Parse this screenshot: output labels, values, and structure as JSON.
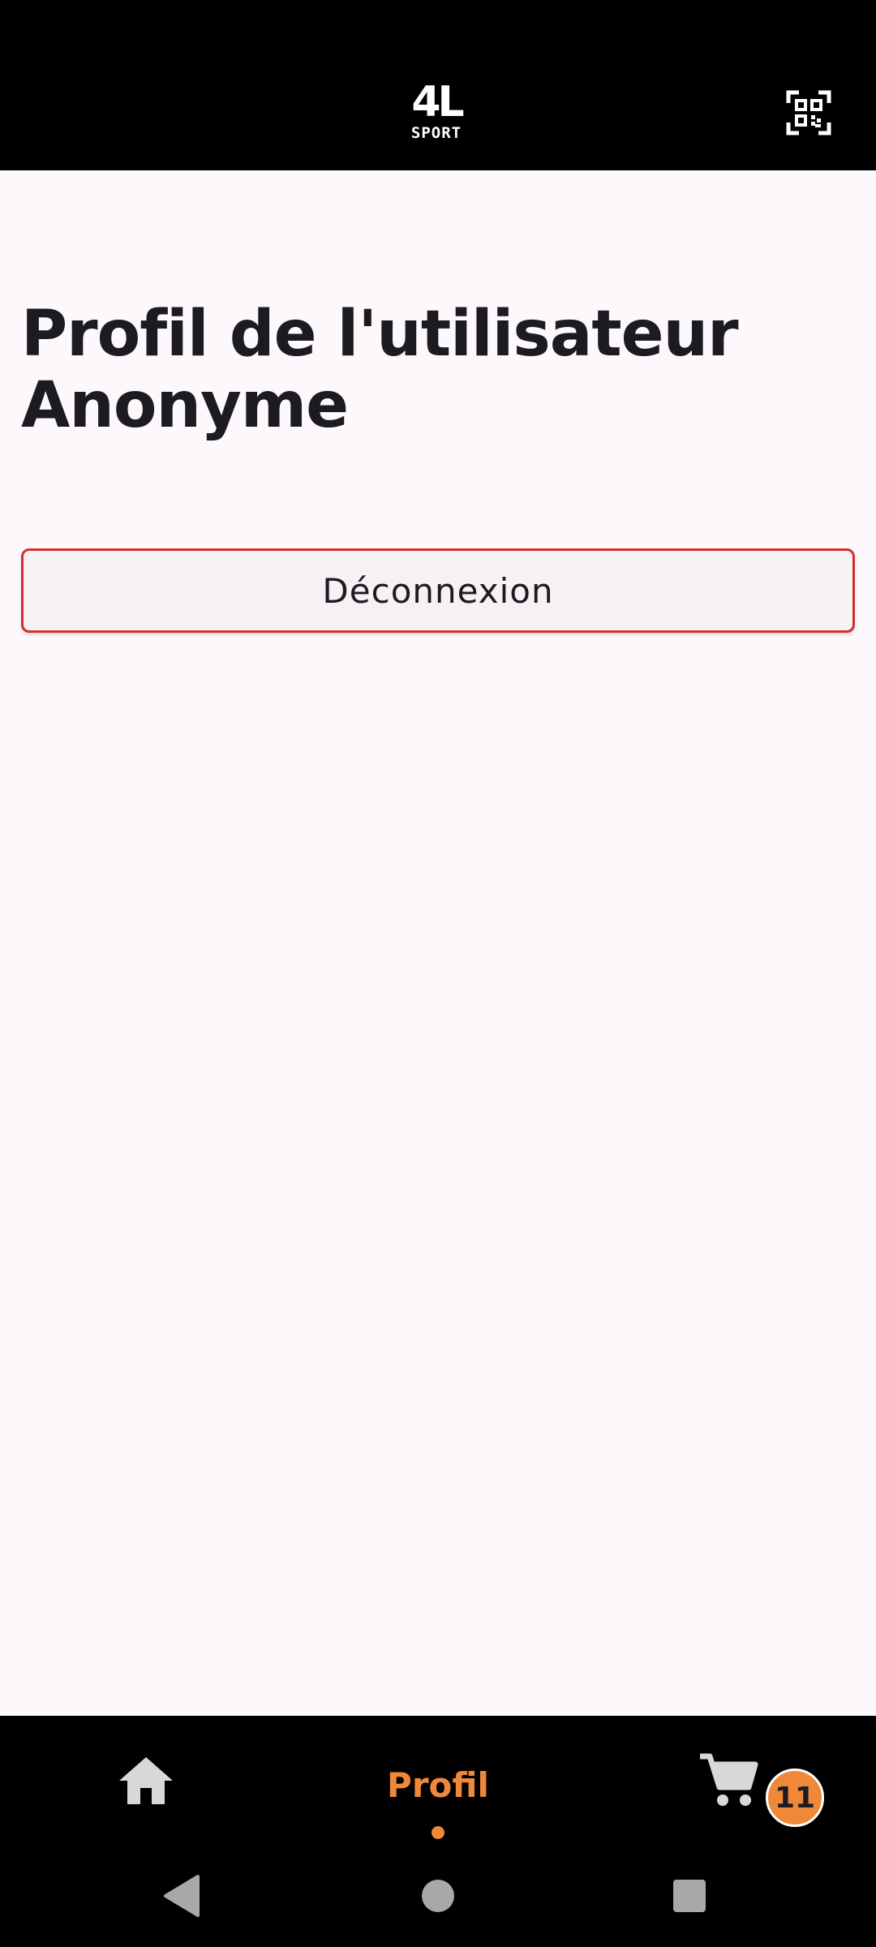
{
  "header": {
    "logo_mark": "4L",
    "logo_word": "SPORT",
    "qr_icon": "qr-code-scan-icon"
  },
  "main": {
    "title": "Profil de l'utilisateur Anonyme",
    "logout_label": "Déconnexion"
  },
  "bottom_nav": {
    "home_icon": "home-icon",
    "active_label": "Profil",
    "cart_icon": "cart-icon",
    "cart_count": "11"
  },
  "system_nav": {
    "back_icon": "back-triangle-icon",
    "home_icon": "home-circle-icon",
    "recents_icon": "recents-square-icon"
  },
  "colors": {
    "accent": "#f0883a",
    "background": "#fdf8fc",
    "bars": "#000000",
    "logout_border": "#d32f2f",
    "text": "#1c1b1f"
  }
}
